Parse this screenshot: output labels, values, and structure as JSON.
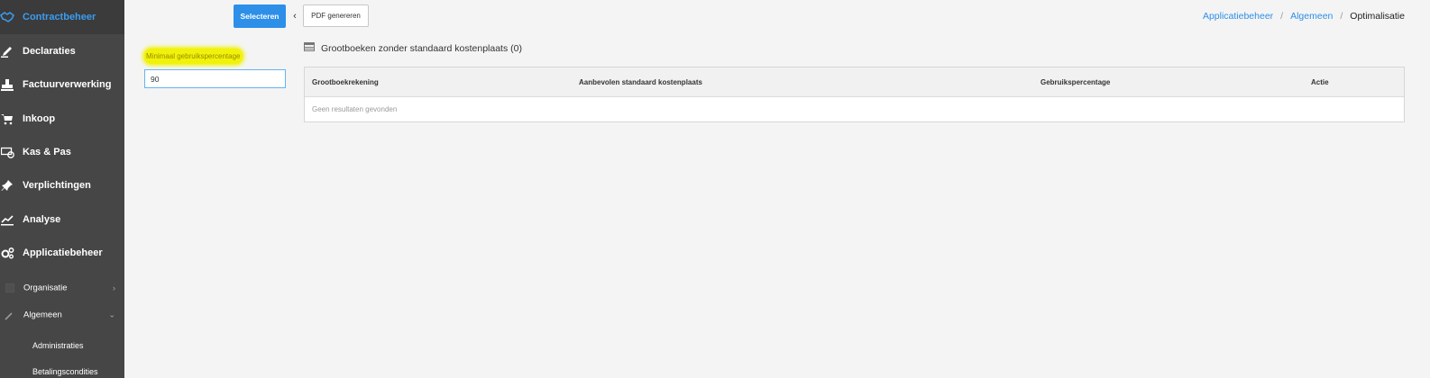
{
  "sidebar": {
    "items": [
      {
        "label": "Contractbeheer",
        "icon": "handshake-icon",
        "active": true
      },
      {
        "label": "Declaraties",
        "icon": "pencil-icon"
      },
      {
        "label": "Factuurverwerking",
        "icon": "stamp-icon"
      },
      {
        "label": "Inkoop",
        "icon": "cart-icon"
      },
      {
        "label": "Kas & Pas",
        "icon": "cash-icon"
      },
      {
        "label": "Verplichtingen",
        "icon": "pin-icon"
      },
      {
        "label": "Analyse",
        "icon": "line-chart-icon"
      },
      {
        "label": "Applicatiebeheer",
        "icon": "gears-icon"
      }
    ],
    "subitems": [
      {
        "label": "Organisatie",
        "icon": "square-icon",
        "chevron": "›"
      },
      {
        "label": "Algemeen",
        "icon": "wrench-icon",
        "chevron": "⌄"
      }
    ],
    "subsubitems": [
      {
        "label": "Administraties"
      },
      {
        "label": "Betalingscondities"
      }
    ]
  },
  "toolbar": {
    "select_label": "Selecteren",
    "collapse_glyph": "‹",
    "pdf_label": "PDF genereren"
  },
  "breadcrumb": {
    "items": [
      "Applicatiebeheer",
      "Algemeen"
    ],
    "separator": "/",
    "current": "Optimalisatie"
  },
  "filter": {
    "label": "Minimaal gebruikspercentage",
    "value": "90"
  },
  "panel": {
    "title": "Grootboeken zonder standaard kostenplaats (0)",
    "icon": "table-icon",
    "columns": [
      "Grootboekrekening",
      "Aanbevolen standaard kostenplaats",
      "Gebruikspercentage",
      "Actie"
    ],
    "empty_text": "Geen resultaten gevonden"
  },
  "colors": {
    "accent": "#2d8fe8",
    "sidebar_bg": "#464646",
    "highlight": "#f1f20a"
  }
}
